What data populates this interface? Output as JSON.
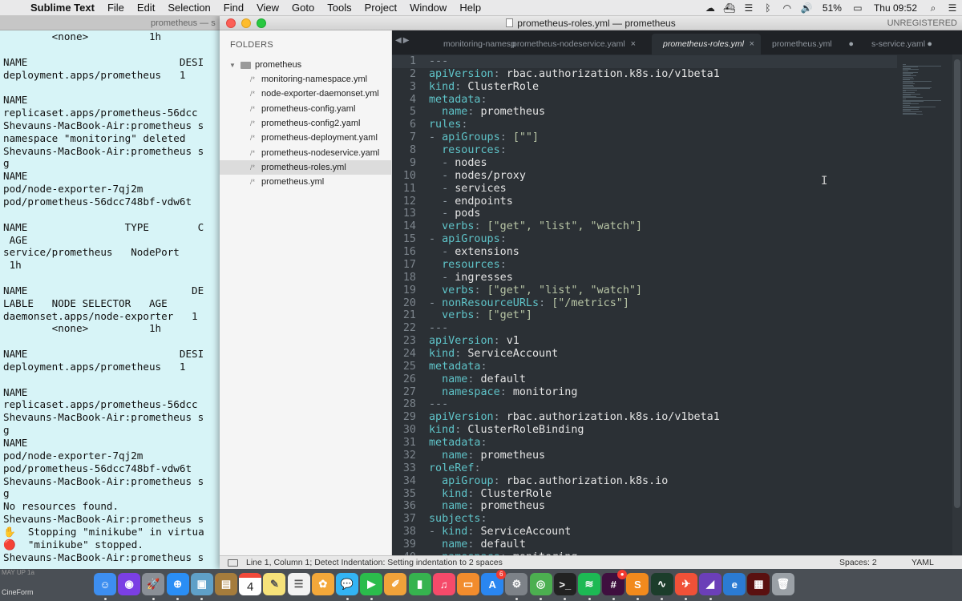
{
  "menubar": {
    "app": "Sublime Text",
    "items": [
      "File",
      "Edit",
      "Selection",
      "Find",
      "View",
      "Goto",
      "Tools",
      "Project",
      "Window",
      "Help"
    ],
    "battery": "51%",
    "clock": "Thu 09:52"
  },
  "terminal": {
    "title": "prometheus — s",
    "lines": [
      "        <none>          1h",
      "",
      "NAME                         DESI",
      "deployment.apps/prometheus   1",
      "",
      "NAME",
      "replicaset.apps/prometheus-56dcc",
      "Shevauns-MacBook-Air:prometheus s",
      "namespace \"monitoring\" deleted",
      "Shevauns-MacBook-Air:prometheus s",
      "g",
      "NAME",
      "pod/node-exporter-7qj2m",
      "pod/prometheus-56dcc748bf-vdw6t",
      "",
      "NAME                TYPE        C",
      " AGE",
      "service/prometheus   NodePort     ",
      " 1h",
      "",
      "NAME                           DE",
      "LABLE   NODE SELECTOR   AGE",
      "daemonset.apps/node-exporter   1",
      "        <none>          1h",
      "",
      "NAME                         DESI",
      "deployment.apps/prometheus   1",
      "",
      "NAME",
      "replicaset.apps/prometheus-56dcc",
      "Shevauns-MacBook-Air:prometheus s",
      "g",
      "NAME",
      "pod/node-exporter-7qj2m",
      "pod/prometheus-56dcc748bf-vdw6t",
      "Shevauns-MacBook-Air:prometheus s",
      "g",
      "No resources found.",
      "Shevauns-MacBook-Air:prometheus s",
      "✋  Stopping \"minikube\" in virtua",
      "🔴  \"minikube\" stopped.",
      "Shevauns-MacBook-Air:prometheus s"
    ]
  },
  "window": {
    "title": "prometheus-roles.yml — prometheus",
    "unregistered": "UNREGISTERED"
  },
  "sidebar": {
    "heading": "FOLDERS",
    "folder": "prometheus",
    "files": [
      "monitoring-namespace.yml",
      "node-exporter-daemonset.yml",
      "prometheus-config.yaml",
      "prometheus-config2.yaml",
      "prometheus-deployment.yaml",
      "prometheus-nodeservice.yaml",
      "prometheus-roles.yml",
      "prometheus.yml"
    ],
    "active_index": 6
  },
  "tabs": [
    {
      "label": "monitoring-namesp",
      "active": false,
      "close": ""
    },
    {
      "label": "prometheus-nodeservice.yaml",
      "active": false,
      "close": "×"
    },
    {
      "label": "prometheus-roles.yml",
      "active": true,
      "close": "×"
    },
    {
      "label": "prometheus.yml",
      "active": false,
      "close": "●"
    },
    {
      "label": "s-service.yaml",
      "active": false,
      "close": "●"
    }
  ],
  "editor": {
    "current_line": 1,
    "lines": [
      [
        [
          "p",
          "---"
        ]
      ],
      [
        [
          "k",
          "apiVersion"
        ],
        [
          "p",
          ": "
        ],
        [
          "v",
          "rbac.authorization.k8s.io/v1beta1"
        ]
      ],
      [
        [
          "k",
          "kind"
        ],
        [
          "p",
          ": "
        ],
        [
          "v",
          "ClusterRole"
        ]
      ],
      [
        [
          "k",
          "metadata"
        ],
        [
          "p",
          ":"
        ]
      ],
      [
        [
          "v",
          "  "
        ],
        [
          "k",
          "name"
        ],
        [
          "p",
          ": "
        ],
        [
          "v",
          "prometheus"
        ]
      ],
      [
        [
          "k",
          "rules"
        ],
        [
          "p",
          ":"
        ]
      ],
      [
        [
          "p",
          "- "
        ],
        [
          "k",
          "apiGroups"
        ],
        [
          "p",
          ": "
        ],
        [
          "s",
          "[\"\"]"
        ]
      ],
      [
        [
          "v",
          "  "
        ],
        [
          "k",
          "resources"
        ],
        [
          "p",
          ":"
        ]
      ],
      [
        [
          "p",
          "  - "
        ],
        [
          "v",
          "nodes"
        ]
      ],
      [
        [
          "p",
          "  - "
        ],
        [
          "v",
          "nodes/proxy"
        ]
      ],
      [
        [
          "p",
          "  - "
        ],
        [
          "v",
          "services"
        ]
      ],
      [
        [
          "p",
          "  - "
        ],
        [
          "v",
          "endpoints"
        ]
      ],
      [
        [
          "p",
          "  - "
        ],
        [
          "v",
          "pods"
        ]
      ],
      [
        [
          "v",
          "  "
        ],
        [
          "k",
          "verbs"
        ],
        [
          "p",
          ": "
        ],
        [
          "s",
          "[\"get\", \"list\", \"watch\"]"
        ]
      ],
      [
        [
          "p",
          "- "
        ],
        [
          "k",
          "apiGroups"
        ],
        [
          "p",
          ":"
        ]
      ],
      [
        [
          "p",
          "  - "
        ],
        [
          "v",
          "extensions"
        ]
      ],
      [
        [
          "v",
          "  "
        ],
        [
          "k",
          "resources"
        ],
        [
          "p",
          ":"
        ]
      ],
      [
        [
          "p",
          "  - "
        ],
        [
          "v",
          "ingresses"
        ]
      ],
      [
        [
          "v",
          "  "
        ],
        [
          "k",
          "verbs"
        ],
        [
          "p",
          ": "
        ],
        [
          "s",
          "[\"get\", \"list\", \"watch\"]"
        ]
      ],
      [
        [
          "p",
          "- "
        ],
        [
          "k",
          "nonResourceURLs"
        ],
        [
          "p",
          ": "
        ],
        [
          "s",
          "[\"/metrics\"]"
        ]
      ],
      [
        [
          "v",
          "  "
        ],
        [
          "k",
          "verbs"
        ],
        [
          "p",
          ": "
        ],
        [
          "s",
          "[\"get\"]"
        ]
      ],
      [
        [
          "p",
          "---"
        ]
      ],
      [
        [
          "k",
          "apiVersion"
        ],
        [
          "p",
          ": "
        ],
        [
          "v",
          "v1"
        ]
      ],
      [
        [
          "k",
          "kind"
        ],
        [
          "p",
          ": "
        ],
        [
          "v",
          "ServiceAccount"
        ]
      ],
      [
        [
          "k",
          "metadata"
        ],
        [
          "p",
          ":"
        ]
      ],
      [
        [
          "v",
          "  "
        ],
        [
          "k",
          "name"
        ],
        [
          "p",
          ": "
        ],
        [
          "v",
          "default"
        ]
      ],
      [
        [
          "v",
          "  "
        ],
        [
          "k",
          "namespace"
        ],
        [
          "p",
          ": "
        ],
        [
          "v",
          "monitoring"
        ]
      ],
      [
        [
          "p",
          "---"
        ]
      ],
      [
        [
          "k",
          "apiVersion"
        ],
        [
          "p",
          ": "
        ],
        [
          "v",
          "rbac.authorization.k8s.io/v1beta1"
        ]
      ],
      [
        [
          "k",
          "kind"
        ],
        [
          "p",
          ": "
        ],
        [
          "v",
          "ClusterRoleBinding"
        ]
      ],
      [
        [
          "k",
          "metadata"
        ],
        [
          "p",
          ":"
        ]
      ],
      [
        [
          "v",
          "  "
        ],
        [
          "k",
          "name"
        ],
        [
          "p",
          ": "
        ],
        [
          "v",
          "prometheus"
        ]
      ],
      [
        [
          "k",
          "roleRef"
        ],
        [
          "p",
          ":"
        ]
      ],
      [
        [
          "v",
          "  "
        ],
        [
          "k",
          "apiGroup"
        ],
        [
          "p",
          ": "
        ],
        [
          "v",
          "rbac.authorization.k8s.io"
        ]
      ],
      [
        [
          "v",
          "  "
        ],
        [
          "k",
          "kind"
        ],
        [
          "p",
          ": "
        ],
        [
          "v",
          "ClusterRole"
        ]
      ],
      [
        [
          "v",
          "  "
        ],
        [
          "k",
          "name"
        ],
        [
          "p",
          ": "
        ],
        [
          "v",
          "prometheus"
        ]
      ],
      [
        [
          "k",
          "subjects"
        ],
        [
          "p",
          ":"
        ]
      ],
      [
        [
          "p",
          "- "
        ],
        [
          "k",
          "kind"
        ],
        [
          "p",
          ": "
        ],
        [
          "v",
          "ServiceAccount"
        ]
      ],
      [
        [
          "v",
          "  "
        ],
        [
          "k",
          "name"
        ],
        [
          "p",
          ": "
        ],
        [
          "v",
          "default"
        ]
      ],
      [
        [
          "v",
          "  "
        ],
        [
          "k",
          "namespace"
        ],
        [
          "p",
          ": "
        ],
        [
          "v",
          "monitoring"
        ]
      ]
    ]
  },
  "statusbar": {
    "message": "Line 1, Column 1; Detect Indentation: Setting indentation to 2 spaces",
    "spaces": "Spaces: 2",
    "syntax": "YAML"
  },
  "dock": {
    "left_label": "CineForm",
    "left_sublabel": "MAY UP 1a",
    "calendar_day": "4",
    "badges": {
      "app_store": "6",
      "slack": "●"
    },
    "icons": [
      {
        "name": "finder",
        "color": "#3d8ef0",
        "glyph": "☺"
      },
      {
        "name": "siri",
        "color": "#7b3fe4",
        "glyph": "◉"
      },
      {
        "name": "launchpad",
        "color": "#8a8f96",
        "glyph": "🚀"
      },
      {
        "name": "safari",
        "color": "#2a8ef5",
        "glyph": "⊕"
      },
      {
        "name": "preview",
        "color": "#5fa0c8",
        "glyph": "▣"
      },
      {
        "name": "notes-brown",
        "color": "#a57c3c",
        "glyph": "▤"
      },
      {
        "name": "calendar",
        "color": "#ffffff",
        "glyph": ""
      },
      {
        "name": "notes",
        "color": "#f6e27a",
        "glyph": "✎"
      },
      {
        "name": "reminders",
        "color": "#f2f2f2",
        "glyph": "☰"
      },
      {
        "name": "photos",
        "color": "#f4a83a",
        "glyph": "✿"
      },
      {
        "name": "messages",
        "color": "#33b4f4",
        "glyph": "💬"
      },
      {
        "name": "facetime",
        "color": "#2bbc4c",
        "glyph": "▶"
      },
      {
        "name": "pages",
        "color": "#f0a23a",
        "glyph": "✐"
      },
      {
        "name": "numbers",
        "color": "#36b34f",
        "glyph": "▮"
      },
      {
        "name": "music",
        "color": "#f54a6a",
        "glyph": "♫"
      },
      {
        "name": "books",
        "color": "#f28c2d",
        "glyph": "▭"
      },
      {
        "name": "app-store",
        "color": "#2a86f0",
        "glyph": "A"
      },
      {
        "name": "system-preferences",
        "color": "#7d8288",
        "glyph": "⚙"
      },
      {
        "name": "chrome",
        "color": "#4caf50",
        "glyph": "◎"
      },
      {
        "name": "terminal",
        "color": "#222222",
        "glyph": ">_"
      },
      {
        "name": "spotify",
        "color": "#1db954",
        "glyph": "≋"
      },
      {
        "name": "slack",
        "color": "#3f0f3f",
        "glyph": "#"
      },
      {
        "name": "sublime",
        "color": "#f28a1d",
        "glyph": "S"
      },
      {
        "name": "activity-monitor",
        "color": "#1c3d2b",
        "glyph": "∿"
      },
      {
        "name": "swift",
        "color": "#f05138",
        "glyph": "✈"
      },
      {
        "name": "visual-studio",
        "color": "#6b3fb8",
        "glyph": "◢"
      },
      {
        "name": "edge",
        "color": "#2b7bd3",
        "glyph": "e"
      },
      {
        "name": "photo-booth",
        "color": "#5a1010",
        "glyph": "▦"
      },
      {
        "name": "trash",
        "color": "#9aa0a6",
        "glyph": "🗑"
      }
    ]
  }
}
